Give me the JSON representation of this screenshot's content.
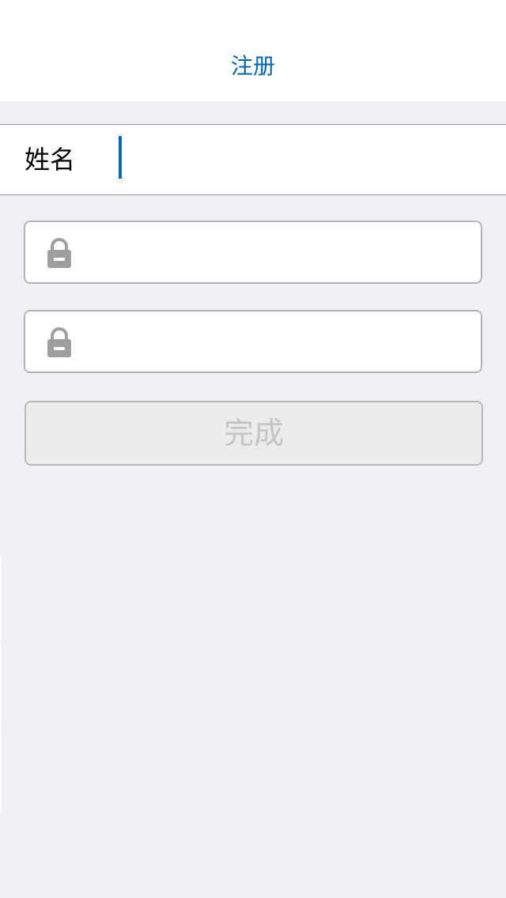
{
  "nav": {
    "title": "注册"
  },
  "form": {
    "name_label": "姓名",
    "name_value": "",
    "password_value": "",
    "confirm_password_value": "",
    "lock_icon": "lock-icon",
    "done_label": "完成"
  },
  "colors": {
    "accent": "#0066b3",
    "background": "#efeff4",
    "disabled_button_bg": "#ebebeb",
    "disabled_button_text": "#c4c4c4",
    "lock_icon": "#9e9e9e"
  }
}
